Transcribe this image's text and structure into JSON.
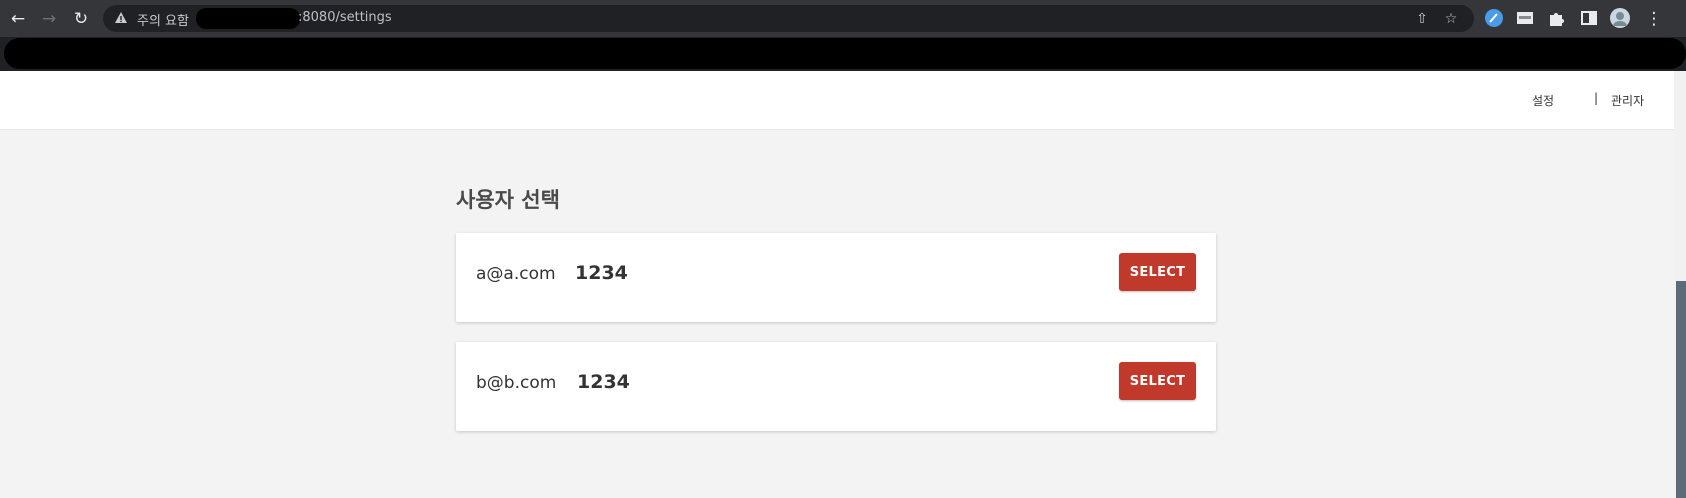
{
  "browser": {
    "security_label": "주의 요함",
    "url_suffix": ":8080/settings"
  },
  "header": {
    "links": [
      "설정",
      "관리자"
    ],
    "separator": "|"
  },
  "main": {
    "title": "사용자 선택",
    "users": [
      {
        "email": "a@a.com",
        "code": "1234",
        "button_label": "SELECT"
      },
      {
        "email": "b@b.com",
        "code": "1234",
        "button_label": "SELECT"
      }
    ]
  },
  "colors": {
    "accent": "#c0392b",
    "chrome_bg": "#202124",
    "page_bg": "#f3f3f3"
  }
}
